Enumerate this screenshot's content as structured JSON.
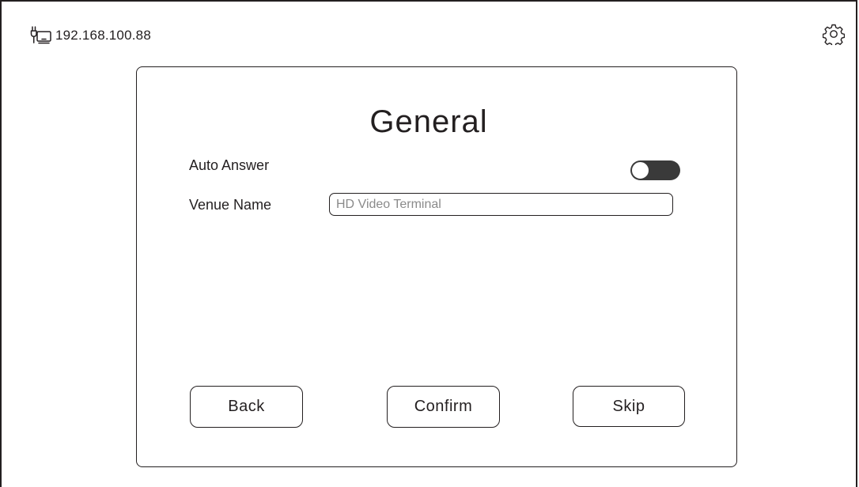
{
  "status": {
    "network_icon": "network-cable-icon",
    "ip_address": "192.168.100.88",
    "settings_icon": "gear-icon"
  },
  "general": {
    "title": "General",
    "auto_answer": {
      "label": "Auto Answer",
      "enabled": false
    },
    "venue_name": {
      "label": "Venue Name",
      "value": "",
      "placeholder": "HD Video Terminal"
    }
  },
  "buttons": {
    "back": "Back",
    "confirm": "Confirm",
    "skip": "Skip"
  }
}
